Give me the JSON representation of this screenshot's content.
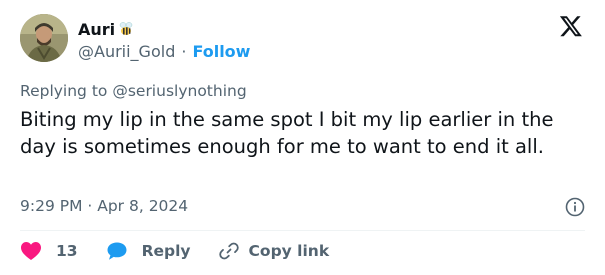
{
  "user": {
    "display_name": "Auri",
    "handle": "@Aurii_Gold",
    "follow_label": "Follow",
    "badge_icon": "bee-icon"
  },
  "reply": {
    "prefix": "Replying to",
    "mention": "@seriuslynothing"
  },
  "tweet": {
    "text": "Biting my lip in the same spot I bit my lip earlier in the day is sometimes enough for me to want to end it all.",
    "timestamp": "9:29 PM · Apr 8, 2024"
  },
  "actions": {
    "like_count": "13",
    "reply_label": "Reply",
    "copy_label": "Copy link"
  },
  "colors": {
    "accent": "#1d9bf0",
    "like": "#f91880",
    "secondary_text": "#536471"
  }
}
